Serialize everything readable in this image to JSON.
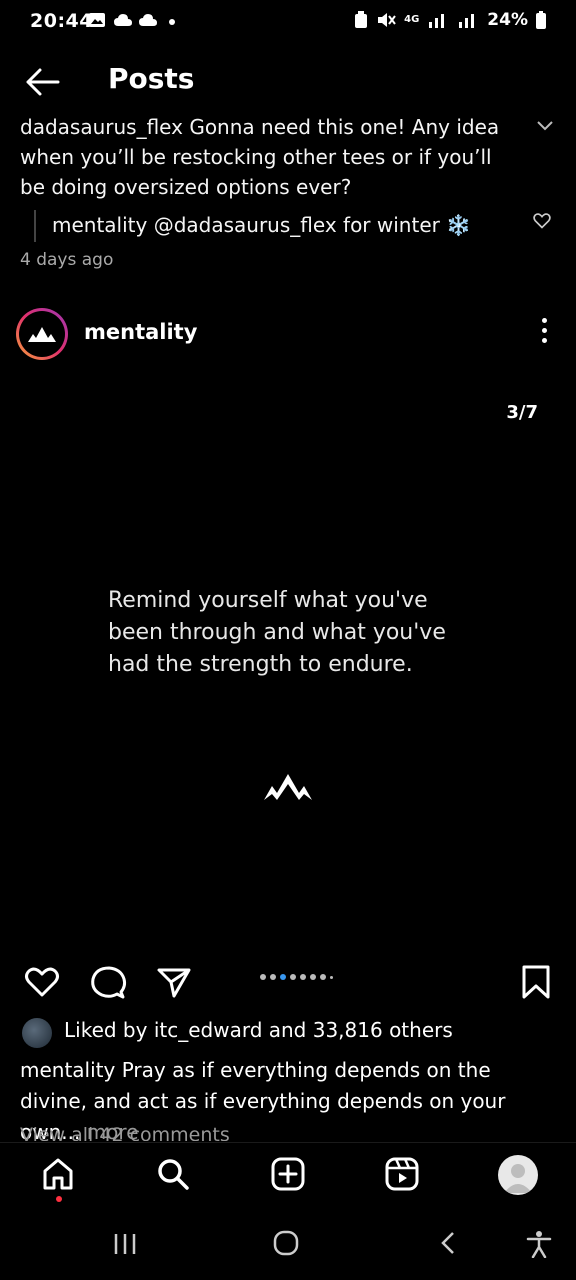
{
  "status_bar": {
    "time": "20:44",
    "network": "4G",
    "battery": "24%"
  },
  "header": {
    "title": "Posts"
  },
  "comment": {
    "text": "dadasaurus_flex Gonna need this one! Any idea when you’ll be restocking other tees or if you’ll be doing oversized options ever?",
    "reply": "mentality @dadasaurus_flex for winter ❄️",
    "time_ago": "4 days ago"
  },
  "post": {
    "username": "mentality",
    "counter": "3/7",
    "quote": "Remind yourself what you've been through and what you've had the strength to endure.",
    "liked_by": "Liked by itc_edward and 33,816 others",
    "caption": "mentality Pray as if everything depends on the divine, and act as if everything depends on your own...",
    "more_label": "more",
    "view_all": "View all 42 comments",
    "carousel": {
      "total": 8,
      "active_index": 3
    }
  },
  "colors": {
    "background": "#000000",
    "accent_blue": "#3897f0",
    "notification_red": "#ff3040"
  },
  "icons": {
    "nav": [
      "home-icon",
      "search-icon",
      "create-icon",
      "reels-icon",
      "profile-avatar"
    ],
    "actions": [
      "heart-icon",
      "comment-icon",
      "share-icon",
      "bookmark-icon"
    ]
  }
}
